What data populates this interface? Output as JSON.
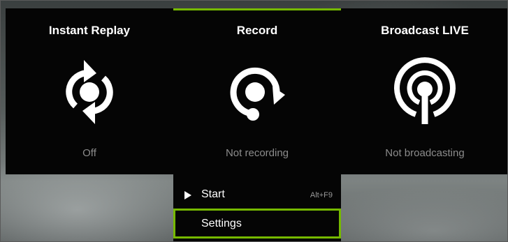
{
  "panels": {
    "instant_replay": {
      "title": "Instant Replay",
      "status": "Off",
      "icon": "instant-replay-icon"
    },
    "record": {
      "title": "Record",
      "status": "Not recording",
      "icon": "record-icon"
    },
    "broadcast": {
      "title": "Broadcast LIVE",
      "status": "Not broadcasting",
      "icon": "broadcast-icon"
    }
  },
  "record_menu": {
    "start": {
      "label": "Start",
      "shortcut": "Alt+F9",
      "icon": "play-icon"
    },
    "settings": {
      "label": "Settings"
    }
  },
  "colors": {
    "accent": "#76b900",
    "panel_background": "#050505",
    "title_text": "#ffffff",
    "status_text": "#8c8c8c"
  }
}
